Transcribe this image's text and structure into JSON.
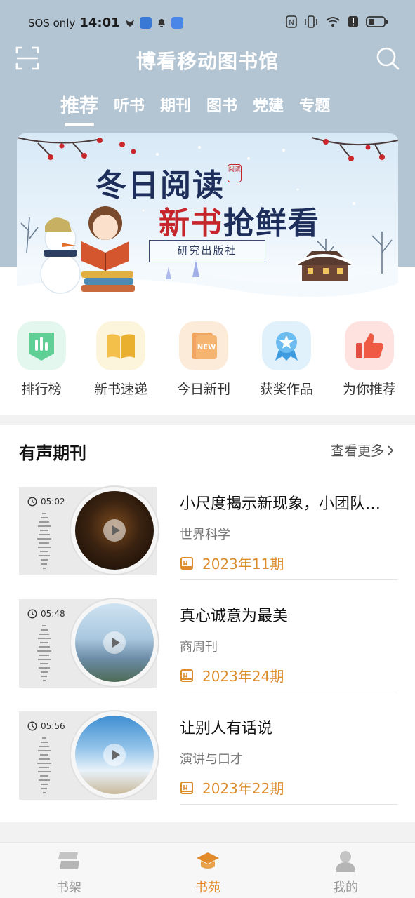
{
  "status_bar": {
    "carrier": "SOS only",
    "time": "14:01"
  },
  "header": {
    "title": "博看移动图书馆",
    "scan_icon": "scan-icon",
    "search_icon": "search-icon"
  },
  "tabs": [
    {
      "label": "推荐",
      "active": true
    },
    {
      "label": "听书",
      "active": false
    },
    {
      "label": "期刊",
      "active": false
    },
    {
      "label": "图书",
      "active": false
    },
    {
      "label": "党建",
      "active": false
    },
    {
      "label": "专题",
      "active": false
    }
  ],
  "banner": {
    "line1": "冬日阅读",
    "line2_red": "新书",
    "line2_rest": "抢鲜看",
    "seal": "阅读",
    "publisher": "研究出版社"
  },
  "quick_menu": [
    {
      "label": "排行榜",
      "icon": "chart-bars-icon"
    },
    {
      "label": "新书速递",
      "icon": "open-book-icon"
    },
    {
      "label": "今日新刊",
      "icon": "new-magazine-icon"
    },
    {
      "label": "获奖作品",
      "icon": "award-medal-icon"
    },
    {
      "label": "为你推荐",
      "icon": "thumbs-up-icon"
    }
  ],
  "audio_section": {
    "title": "有声期刊",
    "more_label": "查看更多",
    "items": [
      {
        "duration": "05:02",
        "title": "小尺度揭示新现象，小团队…",
        "source": "世界科学",
        "issue": "2023年11期"
      },
      {
        "duration": "05:48",
        "title": "真心诚意为最美",
        "source": "商周刊",
        "issue": "2023年24期"
      },
      {
        "duration": "05:56",
        "title": "让别人有话说",
        "source": "演讲与口才",
        "issue": "2023年22期"
      }
    ]
  },
  "bottom_nav": [
    {
      "label": "书架",
      "icon": "bookshelf-icon",
      "active": false
    },
    {
      "label": "书苑",
      "icon": "graduation-cap-icon",
      "active": true
    },
    {
      "label": "我的",
      "icon": "user-icon",
      "active": false
    }
  ],
  "colors": {
    "header_bg": "#b3c5d3",
    "accent_orange": "#e38a2a",
    "issue_orange": "#dd8c2c"
  }
}
